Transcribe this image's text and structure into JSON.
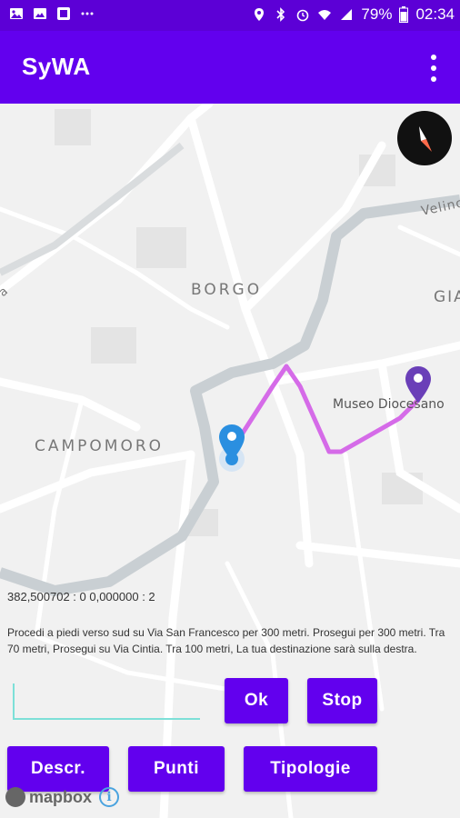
{
  "status_bar": {
    "battery": "79%",
    "time": "02:34",
    "left_icons": [
      "image-icon",
      "gallery-icon",
      "office-icon",
      "more-dots-icon"
    ],
    "right_icons": [
      "location-icon",
      "bluetooth-icon",
      "alarm-icon",
      "wifi-icon",
      "signal-icon",
      "battery-icon"
    ]
  },
  "app_bar": {
    "title": "SyWA"
  },
  "map": {
    "labels": {
      "borgo": "BORGO",
      "campomoro": "CAMPOMORO",
      "museo": "Museo Diocesano",
      "velino": "Velino",
      "gia": "GIA",
      "left_edge": "a"
    },
    "route_color": "#d56be8",
    "start_marker_color": "#2a8fe0",
    "dest_marker_color": "#6a3fb8"
  },
  "coords_text": "382,500702 : 0 0,000000 : 2",
  "instructions_text": "Procedi a piedi verso sud su Via San Francesco per 300 metri. Prosegui per 300 metri. Tra 70 metri, Prosegui su Via Cintia. Tra 100 metri, La tua destinazione sarà sulla destra.",
  "input": {
    "value": ""
  },
  "buttons": {
    "ok": "Ok",
    "stop": "Stop",
    "descr": "Descr.",
    "punti": "Punti",
    "tipologie": "Tipologie"
  },
  "attribution": {
    "logo": "mapbox",
    "info": "i"
  },
  "colors": {
    "primary": "#6200ee",
    "status_bar": "#5c00d6",
    "accent": "#7de0d8"
  }
}
